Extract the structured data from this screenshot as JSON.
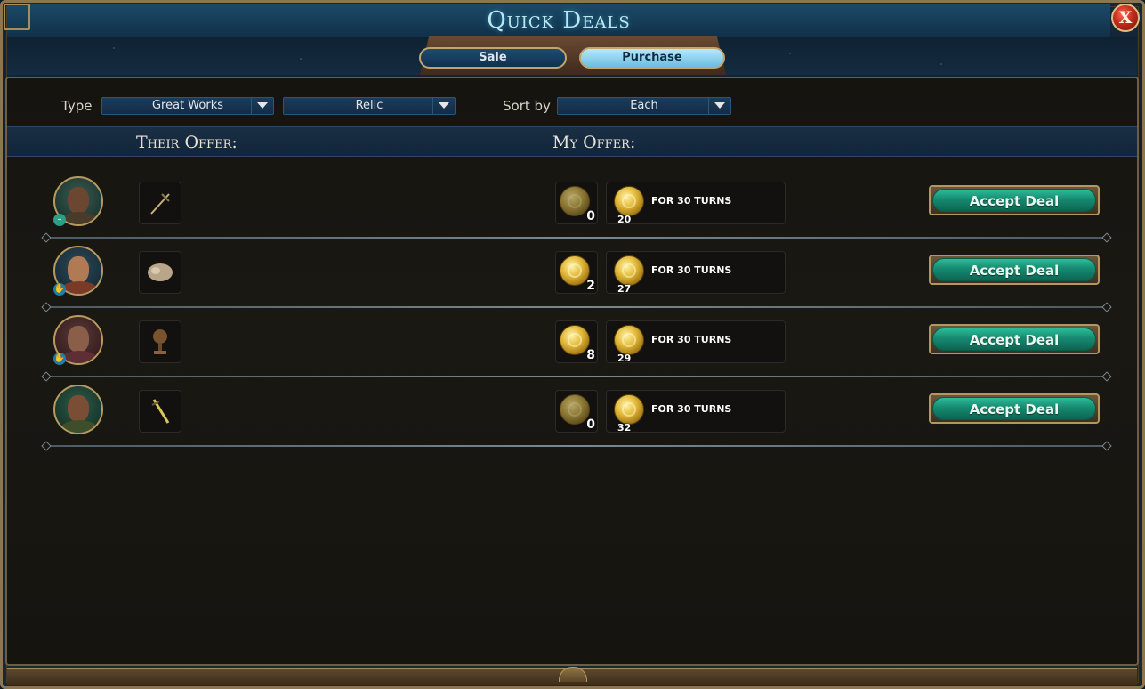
{
  "window": {
    "title": "Quick Deals",
    "close_label": "X"
  },
  "tabs": [
    {
      "label": "Sale",
      "active": false
    },
    {
      "label": "Purchase",
      "active": true
    }
  ],
  "filters": {
    "type_label": "Type",
    "type_value": "Great Works",
    "subtype_value": "Relic",
    "sort_label": "Sort by",
    "sort_value": "Each"
  },
  "columns": {
    "their_offer": "Their Offer:",
    "my_offer": "My Offer:"
  },
  "deals": [
    {
      "leader_icon": "leader-portrait-bearded",
      "status_icon": "neutral-face-icon",
      "item_icon": "crossbow-relic-icon",
      "lump_gold": "0",
      "turns_label": "FOR 30 TURNS",
      "per_turn_gold": "20",
      "accept_label": "Accept Deal"
    },
    {
      "leader_icon": "leader-portrait-woman",
      "status_icon": "handshake-icon",
      "item_icon": "fur-pelt-relic-icon",
      "lump_gold": "2",
      "turns_label": "FOR 30 TURNS",
      "per_turn_gold": "27",
      "accept_label": "Accept Deal"
    },
    {
      "leader_icon": "leader-portrait-elder",
      "status_icon": "handshake-icon",
      "item_icon": "skull-relic-icon",
      "lump_gold": "8",
      "turns_label": "FOR 30 TURNS",
      "per_turn_gold": "29",
      "accept_label": "Accept Deal"
    },
    {
      "leader_icon": "leader-portrait-headband",
      "status_icon": "",
      "item_icon": "dagger-relic-icon",
      "lump_gold": "0",
      "turns_label": "FOR 30 TURNS",
      "per_turn_gold": "32",
      "accept_label": "Accept Deal"
    }
  ],
  "colors": {
    "accent_teal": "#168a70",
    "gold_trim": "#b99a5e",
    "title_glow": "#bfe6f0"
  }
}
